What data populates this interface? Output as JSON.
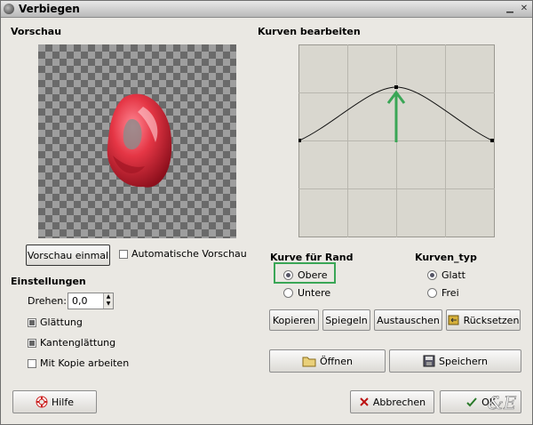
{
  "window": {
    "title": "Verbiegen"
  },
  "preview": {
    "heading": "Vorschau",
    "button_label": "Vorschau einmal",
    "auto_label": "Automatische Vorschau",
    "auto_checked": false
  },
  "settings": {
    "heading": "Einstellungen",
    "rotate_label": "Drehen:",
    "rotate_value": "0,0",
    "smoothing_label": "Glättung",
    "smoothing_checked": true,
    "antialias_label": "Kantenglättung",
    "antialias_checked": true,
    "copy_label": "Mit Kopie arbeiten",
    "copy_checked": false
  },
  "curve": {
    "heading": "Kurven bearbeiten",
    "edge_heading": "Kurve für Rand",
    "edge_options": [
      "Obere",
      "Untere"
    ],
    "edge_selected": "Obere",
    "type_heading": "Kurven_typ",
    "type_options": [
      "Glatt",
      "Frei"
    ],
    "type_selected": "Glatt"
  },
  "buttons": {
    "copy": "Kopieren",
    "mirror": "Spiegeln",
    "swap": "Austauschen",
    "reset": "Rücksetzen",
    "open": "Öffnen",
    "save": "Speichern",
    "help": "Hilfe",
    "cancel": "Abbrechen",
    "ok": "OK"
  },
  "colors": {
    "highlight": "#3aa656",
    "object": "#d6303e"
  }
}
